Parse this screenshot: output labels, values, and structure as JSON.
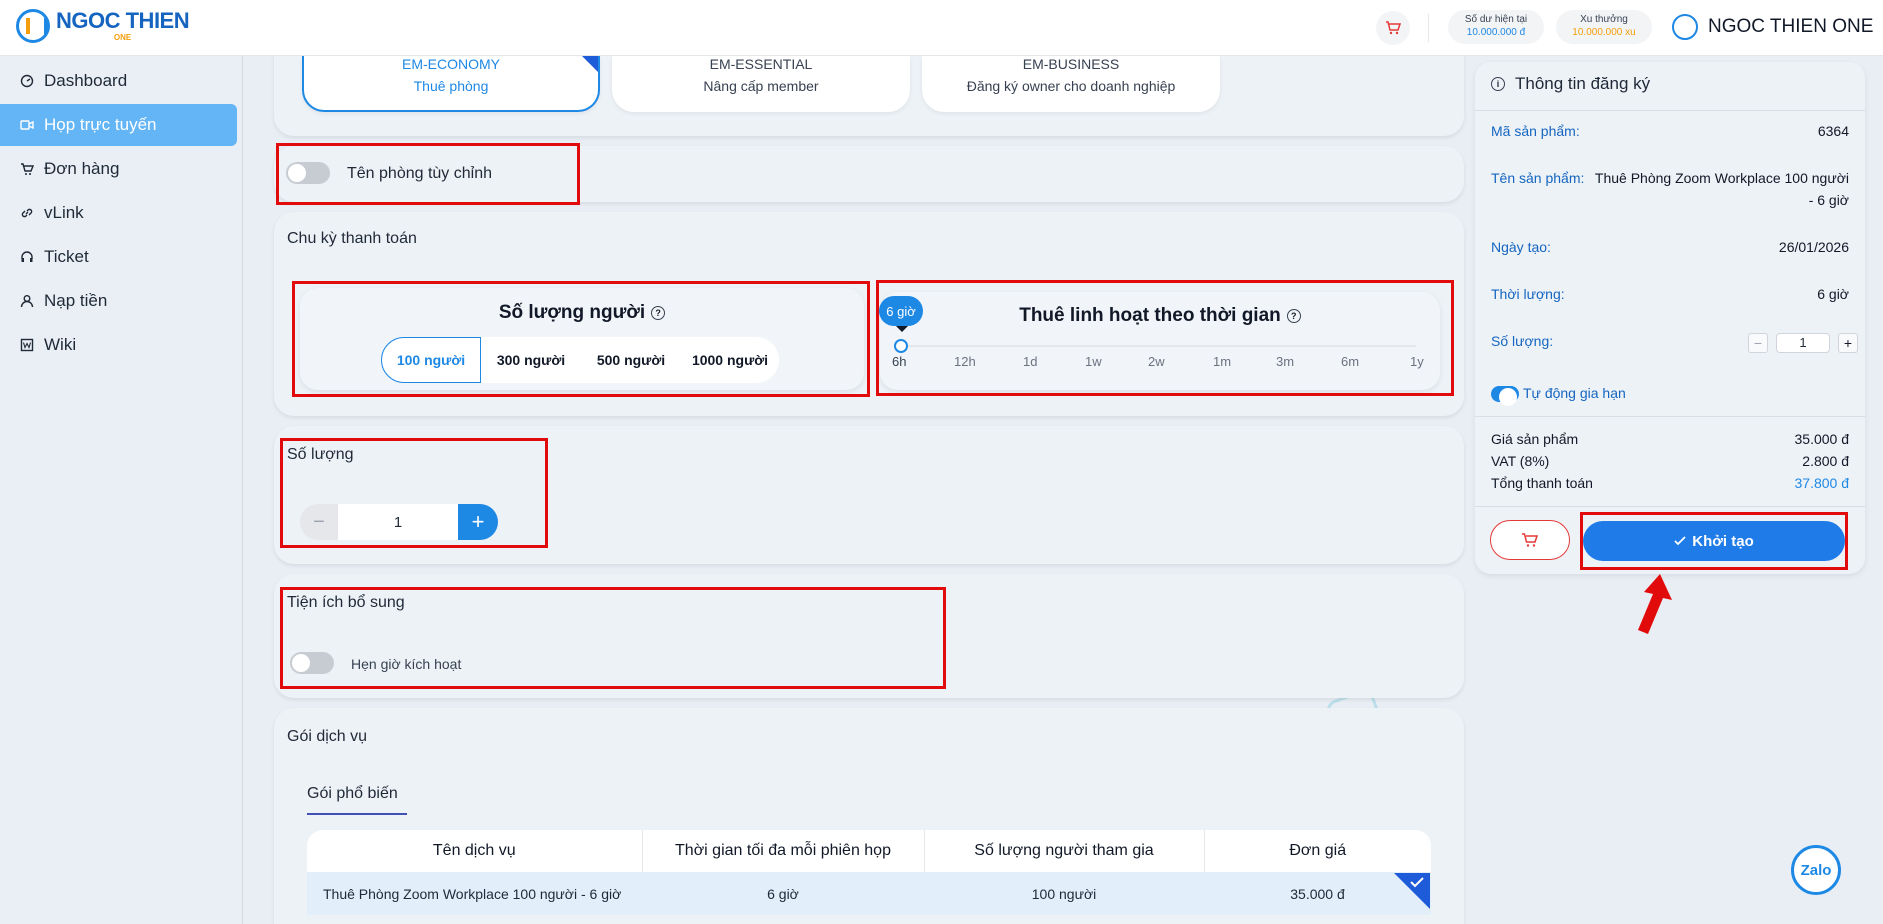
{
  "header": {
    "logo_text": "NGOC THIEN",
    "logo_sub": "ONE",
    "balance_label": "Số dư hiện tại",
    "balance_value": "10.000.000 đ",
    "reward_label": "Xu thưởng",
    "reward_value": "10.000.000 xu",
    "user_name": "NGOC THIEN ONE"
  },
  "sidebar": {
    "items": [
      {
        "label": "Dashboard",
        "icon": "dashboard-icon"
      },
      {
        "label": "Họp trực tuyến",
        "icon": "video-icon"
      },
      {
        "label": "Đơn hàng",
        "icon": "cart-icon"
      },
      {
        "label": "vLink",
        "icon": "link-icon"
      },
      {
        "label": "Ticket",
        "icon": "headset-icon"
      },
      {
        "label": "Nạp tiền",
        "icon": "user-icon"
      },
      {
        "label": "Wiki",
        "icon": "wiki-icon"
      }
    ]
  },
  "tiers": [
    {
      "name": "EM-ECONOMY",
      "desc": "Thuê phòng",
      "selected": true
    },
    {
      "name": "EM-ESSENTIAL",
      "desc": "Nâng cấp member",
      "selected": false
    },
    {
      "name": "EM-BUSINESS",
      "desc": "Đăng ký owner cho doanh nghiệp",
      "selected": false
    }
  ],
  "custom_room": {
    "label": "Tên phòng tùy chỉnh"
  },
  "billing": {
    "title": "Chu kỳ thanh toán",
    "people_title": "Số lượng người",
    "people_options": [
      "100 người",
      "300 người",
      "500 người",
      "1000 người"
    ],
    "time_title": "Thuê linh hoạt theo thời gian",
    "time_bubble": "6 giờ",
    "time_ticks": [
      "6h",
      "12h",
      "1d",
      "1w",
      "2w",
      "1m",
      "3m",
      "6m",
      "1y"
    ]
  },
  "quantity": {
    "title": "Số lượng",
    "value": "1",
    "minus": "−",
    "plus": "+"
  },
  "extras": {
    "title": "Tiện ích bổ sung",
    "schedule_label": "Hẹn giờ kích hoạt"
  },
  "packages": {
    "title": "Gói dịch vụ",
    "tab": "Gói phổ biến",
    "columns": [
      "Tên dịch vụ",
      "Thời gian tối đa mỗi phiên họp",
      "Số lượng người tham gia",
      "Đơn giá"
    ],
    "rows": [
      [
        "Thuê Phòng Zoom Workplace 100 người - 6 giờ",
        "6 giờ",
        "100 người",
        "35.000 đ"
      ]
    ]
  },
  "registration": {
    "title": "Thông tin đăng ký",
    "product_code_label": "Mã sản phẩm:",
    "product_code": "6364",
    "product_name_label": "Tên sản phẩm:",
    "product_name_line1": "Thuê Phòng Zoom Workplace 100 người",
    "product_name_line2": "- 6 giờ",
    "created_label": "Ngày tạo:",
    "created": "26/01/2026",
    "duration_label": "Thời lượng:",
    "duration": "6 giờ",
    "qty_label": "Số lượng:",
    "qty": "1",
    "auto_renew_label": "Tự động gia hạn",
    "price_label": "Giá sản phẩm",
    "price": "35.000 đ",
    "vat_label": "VAT (8%)",
    "vat": "2.800 đ",
    "total_label": "Tổng thanh toán",
    "total": "37.800 đ",
    "create_label": "Khởi tạo"
  },
  "zalo_label": "Zalo",
  "colors": {
    "accent": "#1e88e5",
    "highlight": "#e10b0b",
    "active_nav": "#64b5f6"
  }
}
